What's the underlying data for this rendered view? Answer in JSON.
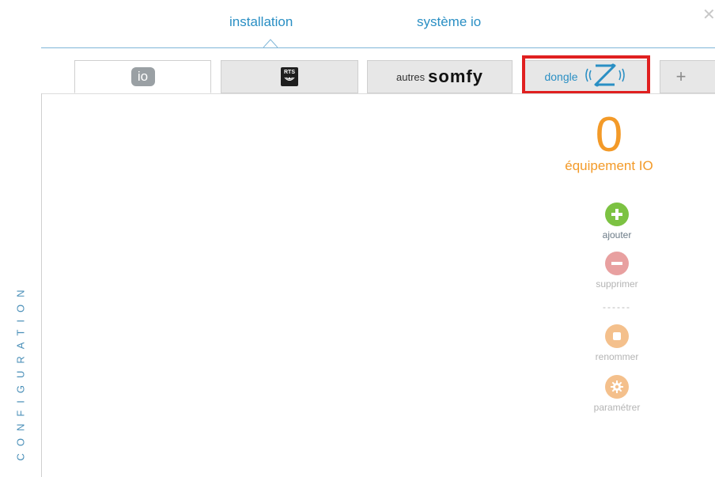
{
  "sidebar": {
    "label": "CONFIGURATION"
  },
  "top_tabs": [
    {
      "label": "installation",
      "active": true
    },
    {
      "label": "système io",
      "active": false
    }
  ],
  "window": {
    "close_icon": "close-icon"
  },
  "device_tabs": {
    "io": {
      "icon": "io-logo-icon",
      "text": "io"
    },
    "rts": {
      "icon": "rts-logo-icon",
      "text": "RTS"
    },
    "somfy": {
      "prefix": "autres",
      "brand": "somfy"
    },
    "dongle": {
      "label": "dongle",
      "icon": "z-wave-icon"
    },
    "add": {
      "icon": "plus-icon",
      "symbol": "+"
    }
  },
  "summary": {
    "count": "0",
    "label": "équipement IO"
  },
  "actions": {
    "add": {
      "label": "ajouter",
      "icon": "plus-circle-icon",
      "color": "#7cc242"
    },
    "delete": {
      "label": "supprimer",
      "icon": "minus-circle-icon",
      "color": "#e8a0a0"
    },
    "separator": "------",
    "rename": {
      "label": "renommer",
      "icon": "stop-circle-icon",
      "color": "#f4c08c"
    },
    "settings": {
      "label": "paramétrer",
      "icon": "gear-circle-icon",
      "color": "#f4c08c"
    }
  },
  "colors": {
    "accent": "#2a8fc4",
    "counter": "#f39a28",
    "highlight": "#e02020"
  }
}
